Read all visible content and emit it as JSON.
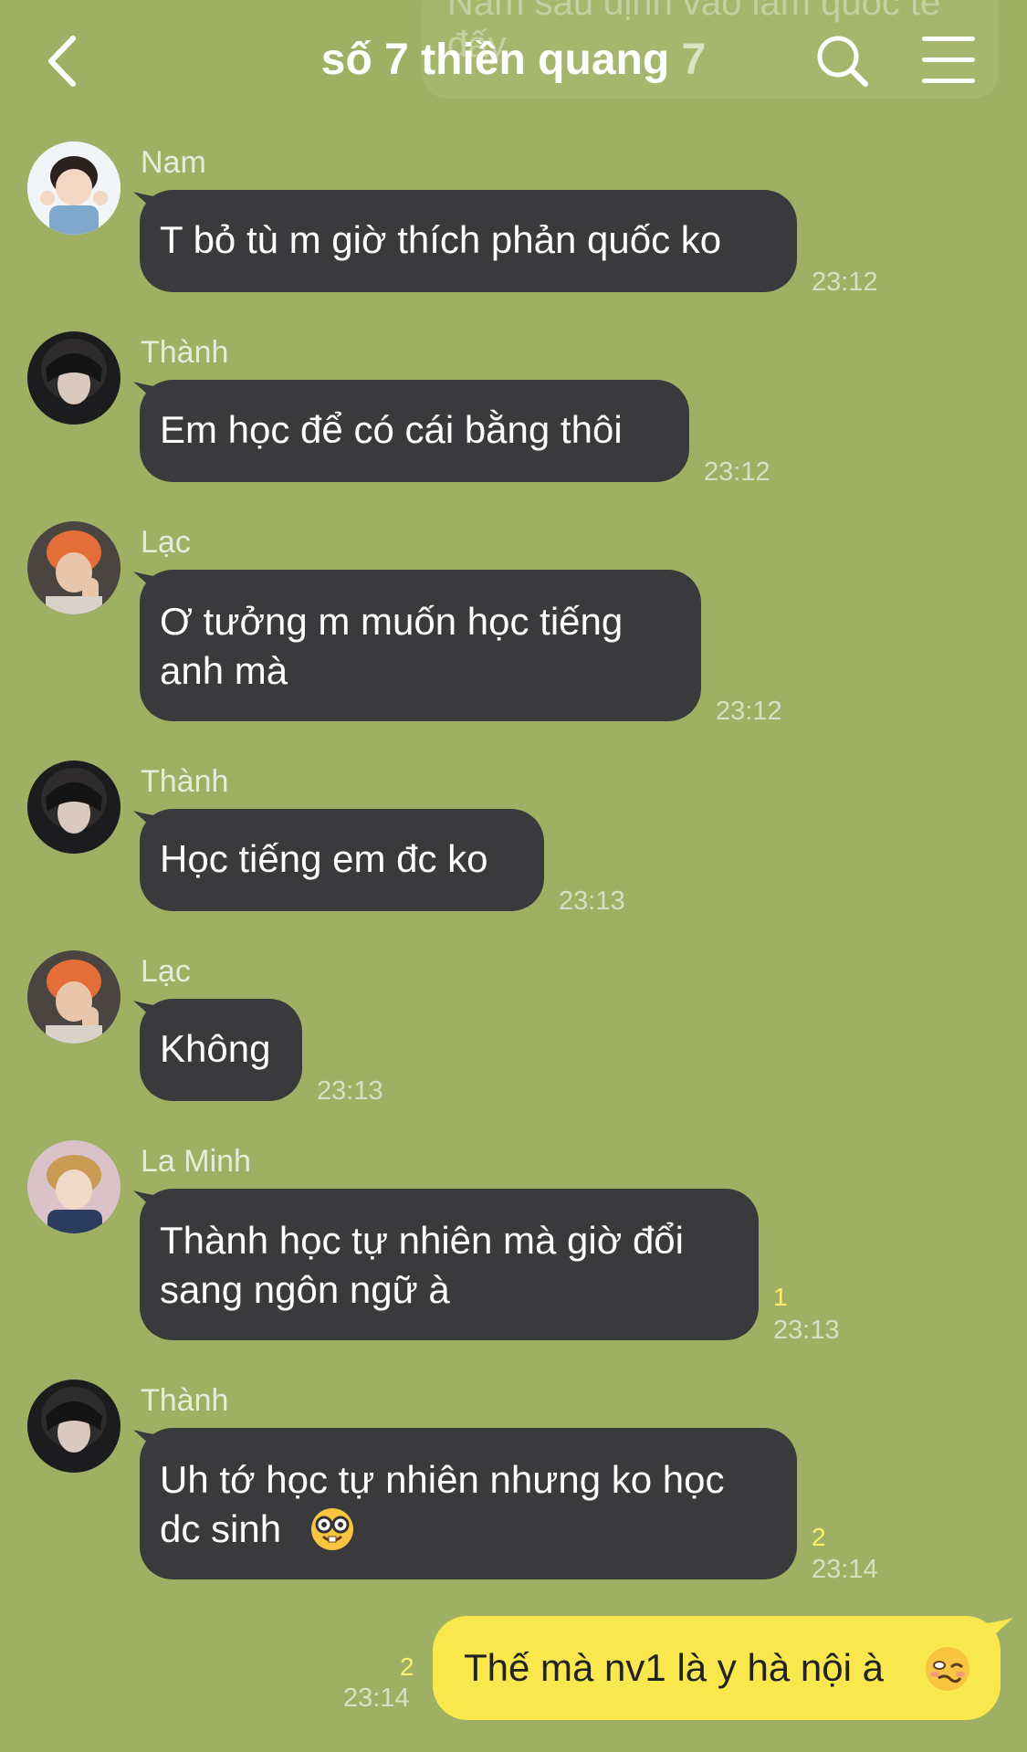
{
  "header": {
    "title": "số 7 thiền quang",
    "member_count": "7"
  },
  "pinned_preview": "Nam sau định vào làm quốc tế đấy",
  "messages": [
    {
      "sender": "Nam",
      "lines": "T bỏ tù m giờ thích phản quốc ko",
      "time": "23:12",
      "unread": ""
    },
    {
      "sender": "Thành",
      "lines": "Em học để có cái bằng thôi",
      "time": "23:12",
      "unread": ""
    },
    {
      "sender": "Lạc",
      "lines": "Ơ  tưởng m muốn học tiếng\nanh mà",
      "time": "23:12",
      "unread": ""
    },
    {
      "sender": "Thành",
      "lines": "Học tiếng em đc ko",
      "time": "23:13",
      "unread": ""
    },
    {
      "sender": "Lạc",
      "lines": "Không",
      "time": "23:13",
      "unread": ""
    },
    {
      "sender": "La Minh",
      "lines": "Thành học tự nhiên mà giờ đổi\nsang ngôn ngữ à",
      "time": "23:13",
      "unread": "1"
    },
    {
      "sender": "Thành",
      "lines": "Uh tớ học tự nhiên nhưng ko học\ndc sinh",
      "time": "23:14",
      "unread": "2"
    }
  ],
  "my_message": {
    "text": "Thế mà nv1 là y hà nội à",
    "time": "23:14",
    "unread": "2"
  },
  "colors": {
    "background": "#9fb064",
    "incoming_bubble": "#3a3a3c",
    "outgoing_bubble": "#f8e84e",
    "unread": "#fbf06a"
  },
  "icons": [
    "back-chevron-icon",
    "search-icon",
    "menu-icon",
    "nerd-face-emoji",
    "woozy-face-emoji"
  ]
}
